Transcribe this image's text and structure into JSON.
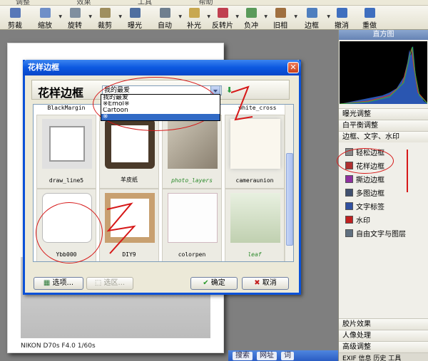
{
  "menubar": {
    "items": [
      "调整",
      "效果",
      "工具",
      "帮助"
    ]
  },
  "toolbar": {
    "buttons": [
      {
        "name": "cut-button",
        "label": "剪裁",
        "color": "#5878b8"
      },
      {
        "name": "resize-button",
        "label": "缩放",
        "color": "#6f8fc8"
      },
      {
        "name": "rotate-button",
        "label": "旋转",
        "color": "#7f8f9f"
      },
      {
        "name": "crop-button",
        "label": "裁剪",
        "color": "#9f8f5f"
      },
      {
        "name": "exposure-button",
        "label": "曝光",
        "color": "#4f6fa0"
      },
      {
        "name": "auto-button",
        "label": "自动",
        "color": "#6f7f8f"
      },
      {
        "name": "fill-light-button",
        "label": "补光",
        "color": "#c8a850"
      },
      {
        "name": "invert-button",
        "label": "反转片",
        "color": "#c04050"
      },
      {
        "name": "negative-button",
        "label": "负冲",
        "color": "#5a9a5a"
      },
      {
        "name": "vintage-button",
        "label": "旧相",
        "color": "#a07040"
      },
      {
        "name": "border-button",
        "label": "边框",
        "color": "#4f7fbf"
      },
      {
        "name": "undo-button",
        "label": "撤消",
        "color": "#3f6fbf"
      },
      {
        "name": "redo-button",
        "label": "重做",
        "color": "#3f6fbf"
      }
    ]
  },
  "photo": {
    "caption": "NIKON D70s F4.0 1/60s"
  },
  "panel": {
    "histogram_title": "直方图",
    "sections": [
      "曝光调整",
      "白平衡调整",
      "边框、文字、水印"
    ],
    "tools": [
      {
        "label": "轻松边框",
        "color": "#888"
      },
      {
        "label": "花样边框",
        "color": "#b03030"
      },
      {
        "label": "撕边边框",
        "color": "#9030a0"
      },
      {
        "label": "多图边框",
        "color": "#405070"
      },
      {
        "label": "文字标签",
        "color": "#3050a0"
      },
      {
        "label": "水印",
        "color": "#c02020"
      },
      {
        "label": "自由文字与图层",
        "color": "#607080"
      }
    ],
    "bottom_sections": [
      "胶片效果",
      "人像处理",
      "高级调整"
    ],
    "bottom_tabs": "EXIF 信息 历史 工具"
  },
  "taskbar": {
    "search": "搜索",
    "url": "网址",
    "word": "词"
  },
  "dialog": {
    "title": "花样边框",
    "heading": "花样边框",
    "combo_value": "我的最爱",
    "dropdown_options": [
      "我的最爱",
      "※Emol※",
      "Cartoon",
      "※"
    ],
    "top_row_labels": [
      "BlackMargin",
      "white_cross"
    ],
    "thumbs": [
      {
        "caption": "draw_line5",
        "style": "plain"
      },
      {
        "caption": "羊皮纸",
        "style": "plain"
      },
      {
        "caption": "photo_layers",
        "style": "green"
      },
      {
        "caption": "cameraunion",
        "style": "plain"
      },
      {
        "caption": "Ybb000",
        "style": "plain"
      },
      {
        "caption": "DIY9",
        "style": "plain"
      },
      {
        "caption": "colorpen",
        "style": "plain"
      },
      {
        "caption": "leaf",
        "style": "green"
      }
    ],
    "btn_select": "选项...",
    "btn_region": "选区...",
    "btn_ok": "确定",
    "btn_cancel": "取消"
  }
}
